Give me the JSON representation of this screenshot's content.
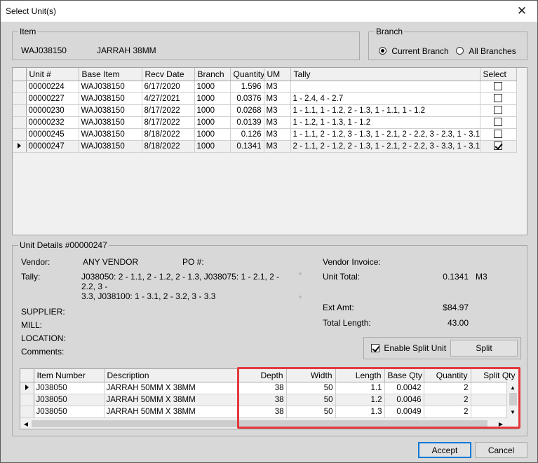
{
  "window": {
    "title": "Select Unit(s)"
  },
  "item": {
    "legend": "Item",
    "code": "WAJ038150",
    "description": "JARRAH 38MM"
  },
  "branch": {
    "legend": "Branch",
    "current_label": "Current Branch",
    "all_label": "All Branches",
    "selected": "current"
  },
  "units_grid": {
    "columns": [
      "Unit #",
      "Base Item",
      "Recv Date",
      "Branch",
      "Quantity",
      "UM",
      "Tally",
      "Select"
    ],
    "rows": [
      {
        "unit": "00000224",
        "base": "WAJ038150",
        "date": "6/17/2020",
        "branch": "1000",
        "qty": "1.596",
        "um": "M3",
        "tally": "",
        "selected": false
      },
      {
        "unit": "00000227",
        "base": "WAJ038150",
        "date": "4/27/2021",
        "branch": "1000",
        "qty": "0.0376",
        "um": "M3",
        "tally": "1 - 2.4, 4 - 2.7",
        "selected": false
      },
      {
        "unit": "00000230",
        "base": "WAJ038150",
        "date": "8/17/2022",
        "branch": "1000",
        "qty": "0.0268",
        "um": "M3",
        "tally": "1 - 1.1, 1 - 1.2, 2 - 1.3, 1 - 1.1, 1 - 1.2",
        "selected": false
      },
      {
        "unit": "00000232",
        "base": "WAJ038150",
        "date": "8/17/2022",
        "branch": "1000",
        "qty": "0.0139",
        "um": "M3",
        "tally": "1 - 1.2, 1 - 1.3, 1 - 1.2",
        "selected": false
      },
      {
        "unit": "00000245",
        "base": "WAJ038150",
        "date": "8/18/2022",
        "branch": "1000",
        "qty": "0.126",
        "um": "M3",
        "tally": "1 - 1.1, 2 - 1.2, 3 - 1.3, 1 - 2.1, 2 - 2.2, 3 - 2.3, 1 - 3.1,",
        "selected": false
      },
      {
        "unit": "00000247",
        "base": "WAJ038150",
        "date": "8/18/2022",
        "branch": "1000",
        "qty": "0.1341",
        "um": "M3",
        "tally": "2 - 1.1, 2 - 1.2, 2 - 1.3, 1 - 2.1, 2 - 2.2, 3 - 3.3, 1 - 3.1,",
        "selected": true
      }
    ]
  },
  "unit_details": {
    "legend": "Unit Details #00000247",
    "vendor_label": "Vendor:",
    "vendor_value": "ANY VENDOR",
    "po_label": "PO #:",
    "tally_label": "Tally:",
    "tally_value_line1": "J038050: 2 - 1.1, 2 - 1.2, 2 - 1.3, J038075: 1 - 2.1, 2 - 2.2, 3 -",
    "tally_value_line2": "3.3, J038100: 1 - 3.1, 2 - 3.2, 3 - 3.3",
    "supplier_label": "SUPPLIER:",
    "mill_label": "MILL:",
    "location_label": "LOCATION:",
    "comments_label": "Comments:",
    "vendor_invoice_label": "Vendor Invoice:",
    "unit_total_label": "Unit Total:",
    "unit_total_value": "0.1341",
    "unit_total_um": "M3",
    "ext_amt_label": "Ext Amt:",
    "ext_amt_value": "$84.97",
    "total_length_label": "Total Length:",
    "total_length_value": "43.00",
    "enable_split_label": "Enable Split Unit",
    "enable_split_checked": true,
    "split_button": "Split"
  },
  "items_grid": {
    "columns": [
      "Item Number",
      "Description",
      "Depth",
      "Width",
      "Length",
      "Base Qty",
      "Quantity",
      "Split Qty"
    ],
    "rows": [
      {
        "item": "J038050",
        "desc": "JARRAH 50MM X 38MM",
        "depth": "38",
        "width": "50",
        "length": "1.1",
        "base_qty": "0.0042",
        "qty": "2",
        "split": ""
      },
      {
        "item": "J038050",
        "desc": "JARRAH 50MM X 38MM",
        "depth": "38",
        "width": "50",
        "length": "1.2",
        "base_qty": "0.0046",
        "qty": "2",
        "split": ""
      },
      {
        "item": "J038050",
        "desc": "JARRAH 50MM X 38MM",
        "depth": "38",
        "width": "50",
        "length": "1.3",
        "base_qty": "0.0049",
        "qty": "2",
        "split": ""
      }
    ]
  },
  "buttons": {
    "accept": "Accept",
    "cancel": "Cancel"
  },
  "colors": {
    "highlight": "#e3393c",
    "accent": "#0078d7"
  }
}
